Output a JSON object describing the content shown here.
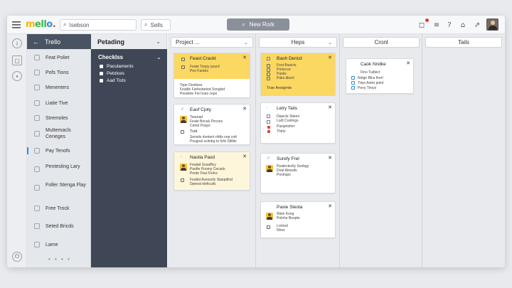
{
  "app": {
    "logo_parts": [
      "m",
      "ell",
      "o",
      "."
    ]
  },
  "topbar": {
    "search1": "Isebson",
    "search2": "Sells",
    "new_button": "New Rork"
  },
  "sidebar": {
    "header": "Trello",
    "items": [
      {
        "label": "Feat Poliet"
      },
      {
        "label": "Pofs Tions"
      },
      {
        "label": "Menenters"
      },
      {
        "label": "Liatie Tive"
      },
      {
        "label": "Stremoles"
      },
      {
        "label": "Muttemacls Ceneges"
      },
      {
        "label": "Pay Tenofs"
      },
      {
        "label": "Pentesting Lary"
      },
      {
        "label": "Foller Stenga Flay"
      },
      {
        "label": "Free Trock"
      },
      {
        "label": "Seted Bricds"
      },
      {
        "label": "Lame"
      }
    ]
  },
  "panel": {
    "header": "Petading",
    "title": "Checklss",
    "items": [
      "Paculaments",
      "Petolces",
      "Aad Tists"
    ]
  },
  "columns": [
    {
      "title": "Project ..."
    },
    {
      "title": "Heps"
    },
    {
      "title": "Cronl"
    },
    {
      "title": "Tails"
    }
  ],
  "cards": {
    "c1": {
      "title": "Feast Crackt",
      "lines": [
        "Feate Toopy pourd",
        "Peo Fardes"
      ],
      "foot": [
        "Tope Destless",
        "Feadle Farfestarted Songlsd",
        "Pesslete Fot hoes cepo"
      ]
    },
    "c2": {
      "title": "Eaof Cjoty",
      "lines": [
        "Tearead",
        "Feate Bocak Pircoes",
        "Cetnd Posps"
      ],
      "sub": "Tuid",
      "foot": [
        "Sensits dontent nfdts nop cott",
        "Posgnal scitntrg to fclls Sitllits"
      ]
    },
    "c3": {
      "title": "Nastia Paxd",
      "lines": [
        "Fealad Sosafficy",
        "Paofte Poomy Cecsds",
        "Poote Fout Fiolcs"
      ],
      "foot": [
        "Feallot Avessofy Slaepdlod",
        "Dpeeal eleficulls"
      ]
    },
    "c4": {
      "title": "Baoh Dericd",
      "lines": [
        "Foot Basicts",
        "Portecce",
        "Pasks",
        "Paks dbect"
      ],
      "foot": "Trae Ansigmte"
    },
    "c5": {
      "title": "Lelry Tatis",
      "lines": [
        "Dejecle Slteen",
        "Lodt Coolings",
        "Pasqetsfort",
        "Thtrls"
      ]
    },
    "c6": {
      "title": "Surefy Frel",
      "lines": [
        "Peatecteclly Sonbgy",
        "Doat Atoeafs",
        "Postraps"
      ]
    },
    "c7": {
      "title": "Paxie Sleota",
      "lines": [
        "Wele Kong",
        "Polohe Bsopte",
        "Lrntred",
        "Nhos"
      ]
    },
    "c8": {
      "title": "Caok Nndke",
      "lines": [
        "Fino Tudlect",
        "Nolge Bfcu firerl",
        "Tdyn Aotrn point",
        "Peny Tiroys"
      ]
    }
  }
}
